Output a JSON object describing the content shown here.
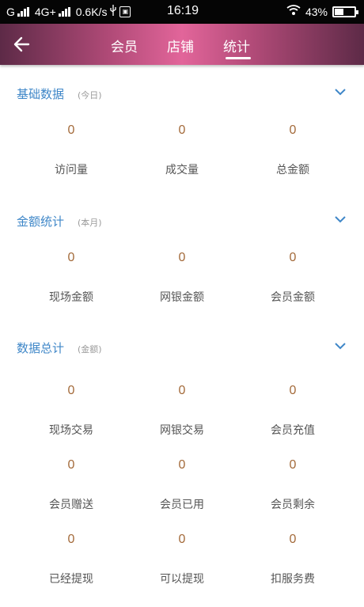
{
  "status_bar": {
    "network_left": "G",
    "network_mid": "4G+",
    "speed": "0.6K/s",
    "time": "16:19",
    "battery": "43%"
  },
  "app_bar": {
    "tabs": [
      {
        "label": "会员"
      },
      {
        "label": "店铺"
      },
      {
        "label": "统计",
        "active": true
      }
    ]
  },
  "sections": [
    {
      "title": "基础数据",
      "subtitle": "(今日)",
      "stats": [
        {
          "value": "0",
          "label": "访问量"
        },
        {
          "value": "0",
          "label": "成交量"
        },
        {
          "value": "0",
          "label": "总金额"
        }
      ]
    },
    {
      "title": "金额统计",
      "subtitle": "(本月)",
      "stats": [
        {
          "value": "0",
          "label": "现场金额"
        },
        {
          "value": "0",
          "label": "网银金额"
        },
        {
          "value": "0",
          "label": "会员金额"
        }
      ]
    },
    {
      "title": "数据总计",
      "subtitle": "(金额)",
      "stats": [
        {
          "value": "0",
          "label": "现场交易"
        },
        {
          "value": "0",
          "label": "网银交易"
        },
        {
          "value": "0",
          "label": "会员充值"
        },
        {
          "value": "0",
          "label": "会员赠送"
        },
        {
          "value": "0",
          "label": "会员已用"
        },
        {
          "value": "0",
          "label": "会员剩余"
        },
        {
          "value": "0",
          "label": "已经提现"
        },
        {
          "value": "0",
          "label": "可以提现"
        },
        {
          "value": "0",
          "label": "扣服务费"
        }
      ]
    }
  ],
  "colors": {
    "accent": "#3f87c8",
    "value": "#a36a3a",
    "appbar_center": "#e2659a",
    "appbar_edge": "#5d2a47"
  }
}
